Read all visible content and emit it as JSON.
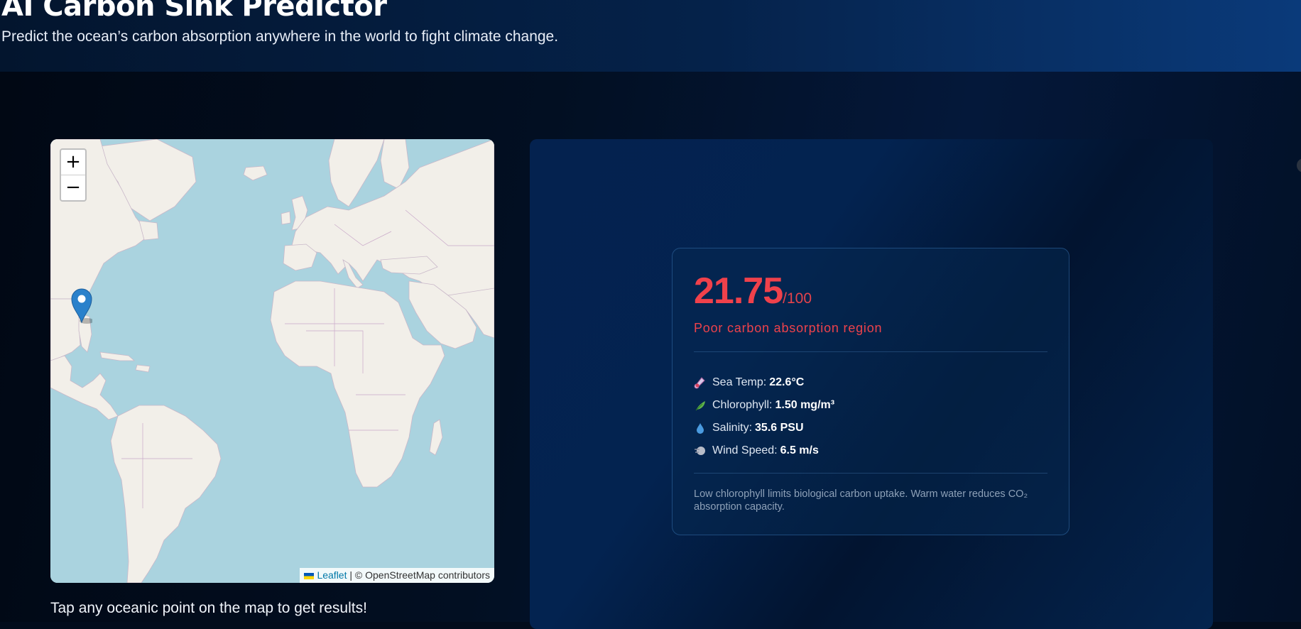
{
  "header": {
    "title": "AI Carbon Sink Predictor",
    "subtitle": "Predict the ocean’s carbon absorption anywhere in the world to fight climate change."
  },
  "map": {
    "zoom_in_label": "+",
    "zoom_out_label": "−",
    "attribution": {
      "link_text": "Leaflet",
      "separator": "|",
      "osm_text": "© OpenStreetMap contributors"
    },
    "marker_icon": "map-pin-icon",
    "hint": "Tap any oceanic point on the map to get results!"
  },
  "result": {
    "score": "21.75",
    "score_max": "/100",
    "rating": "Poor carbon absorption region",
    "metrics": [
      {
        "icon": "thermometer-icon",
        "label": "Sea Temp:",
        "value": "22.6°C"
      },
      {
        "icon": "leaf-icon",
        "label": "Chlorophyll:",
        "value": "1.50 mg/m³"
      },
      {
        "icon": "droplet-icon",
        "label": "Salinity:",
        "value": "35.6 PSU"
      },
      {
        "icon": "wind-icon",
        "label": "Wind Speed:",
        "value": "6.5 m/s"
      }
    ],
    "note": "Low chlorophyll limits biological carbon uptake. Warm water reduces CO₂ absorption capacity."
  },
  "colors": {
    "score": "#f0414b",
    "ocean": "#aad3df",
    "land": "#f2efe9",
    "marker": "#2a81cb"
  }
}
